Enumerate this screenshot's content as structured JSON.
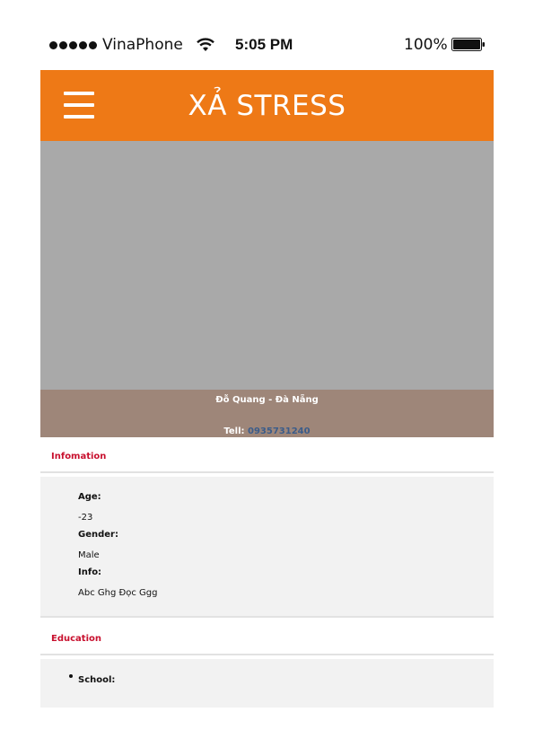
{
  "status_bar": {
    "carrier": "VinaPhone",
    "time": "5:05 PM",
    "battery": "100%"
  },
  "header": {
    "title": "XẢ STRESS"
  },
  "profile": {
    "name": "Đỗ Quang - Đà Nẵng",
    "tell_label": "Tell:",
    "phone": "0935731240"
  },
  "information": {
    "title": "Infomation",
    "fields": [
      {
        "label": "Age:",
        "value": "-23"
      },
      {
        "label": "Gender:",
        "value": "Male"
      },
      {
        "label": "Info:",
        "value": "Abc Ghg Đọc Ggg"
      }
    ]
  },
  "education": {
    "title": "Education",
    "school_label": "School:"
  },
  "colors": {
    "header_bg": "#ee7916",
    "cover_bg": "#a9a9a9",
    "band_bg": "#9e8679",
    "section_title": "#c8102e",
    "phone_link": "#3b5c8a"
  },
  "icons": [
    "signal-icon",
    "wifi-icon",
    "battery-icon",
    "menu-icon"
  ]
}
